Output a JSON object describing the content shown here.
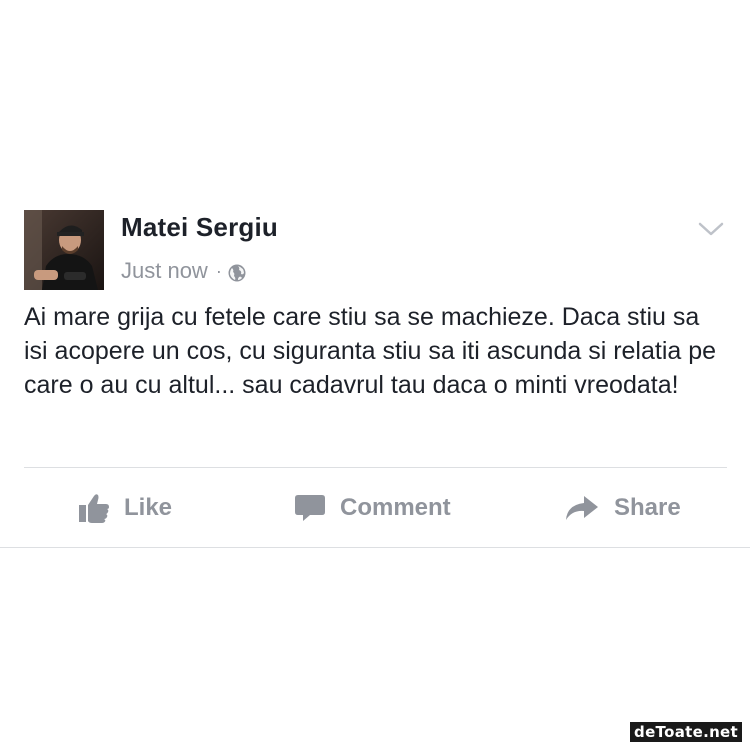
{
  "post": {
    "author": "Matei Sergiu",
    "timestamp": "Just now",
    "separator": "·",
    "privacy_icon": "globe-icon",
    "menu_icon": "chevron-down-icon",
    "text": "Ai mare grija cu fetele care stiu sa se machieze. Daca stiu sa isi acopere un cos, cu siguranta stiu sa iti ascunda si relatia pe care o au cu altul... sau cadavrul tau daca o minti vreodata!"
  },
  "actions": {
    "like_label": "Like",
    "comment_label": "Comment",
    "share_label": "Share"
  },
  "watermark": "deToate.net",
  "colors": {
    "text_primary": "#1d2129",
    "text_secondary": "#90949c",
    "divider": "#dddfe2",
    "background": "#ffffff"
  }
}
